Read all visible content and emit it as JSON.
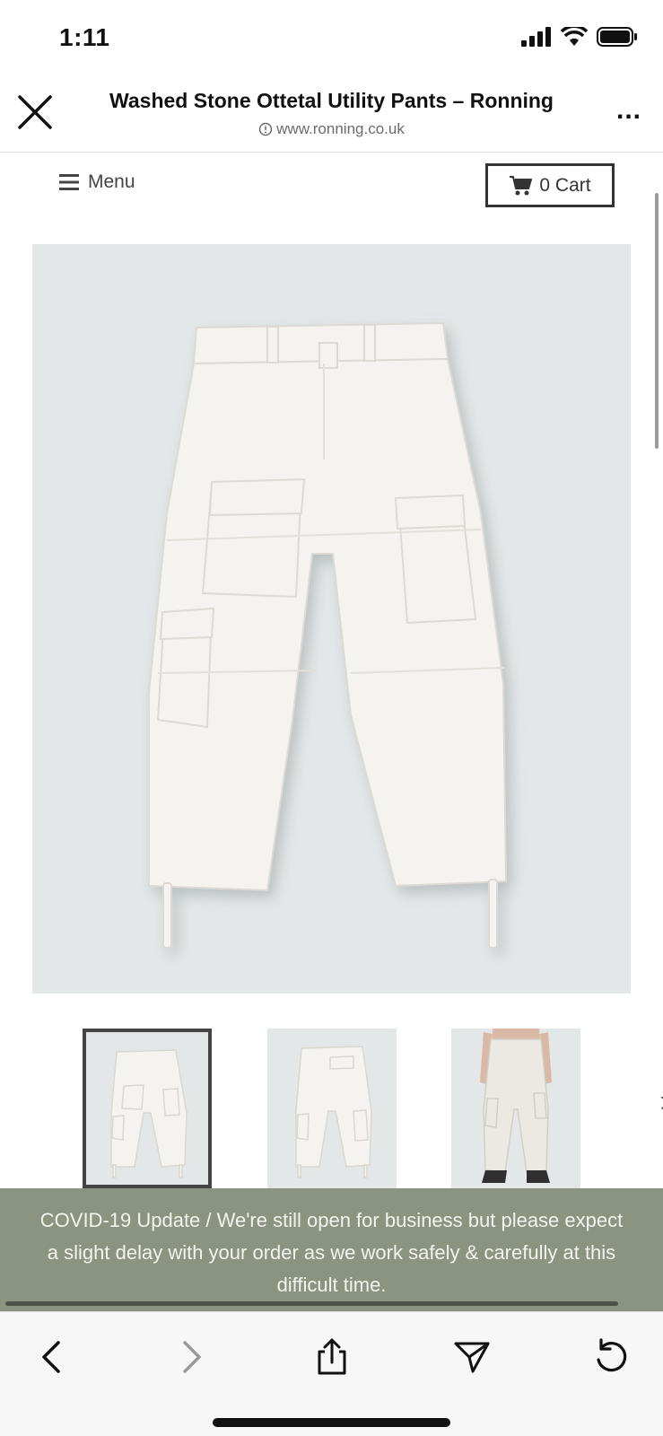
{
  "status": {
    "time": "1:11"
  },
  "browser": {
    "title": "Washed Stone Ottetal Utility Pants – Ronning",
    "url": "www.ronning.co.uk",
    "more": "..."
  },
  "nav": {
    "menu_label": "Menu",
    "cart_label": "0 Cart"
  },
  "product": {
    "thumbnails": [
      {
        "icon": "pants-front-thumbnail",
        "selected": true
      },
      {
        "icon": "pants-back-thumbnail",
        "selected": false
      },
      {
        "icon": "pants-model-thumbnail",
        "selected": false
      }
    ]
  },
  "banner": {
    "text": "COVID-19 Update / We're still open for business but please expect a slight delay with your order as we work safely & carefully at this difficult time."
  },
  "colors": {
    "banner_bg": "#8b9480",
    "image_bg": "#e3e7e8",
    "pants": "#f4f3ef"
  }
}
